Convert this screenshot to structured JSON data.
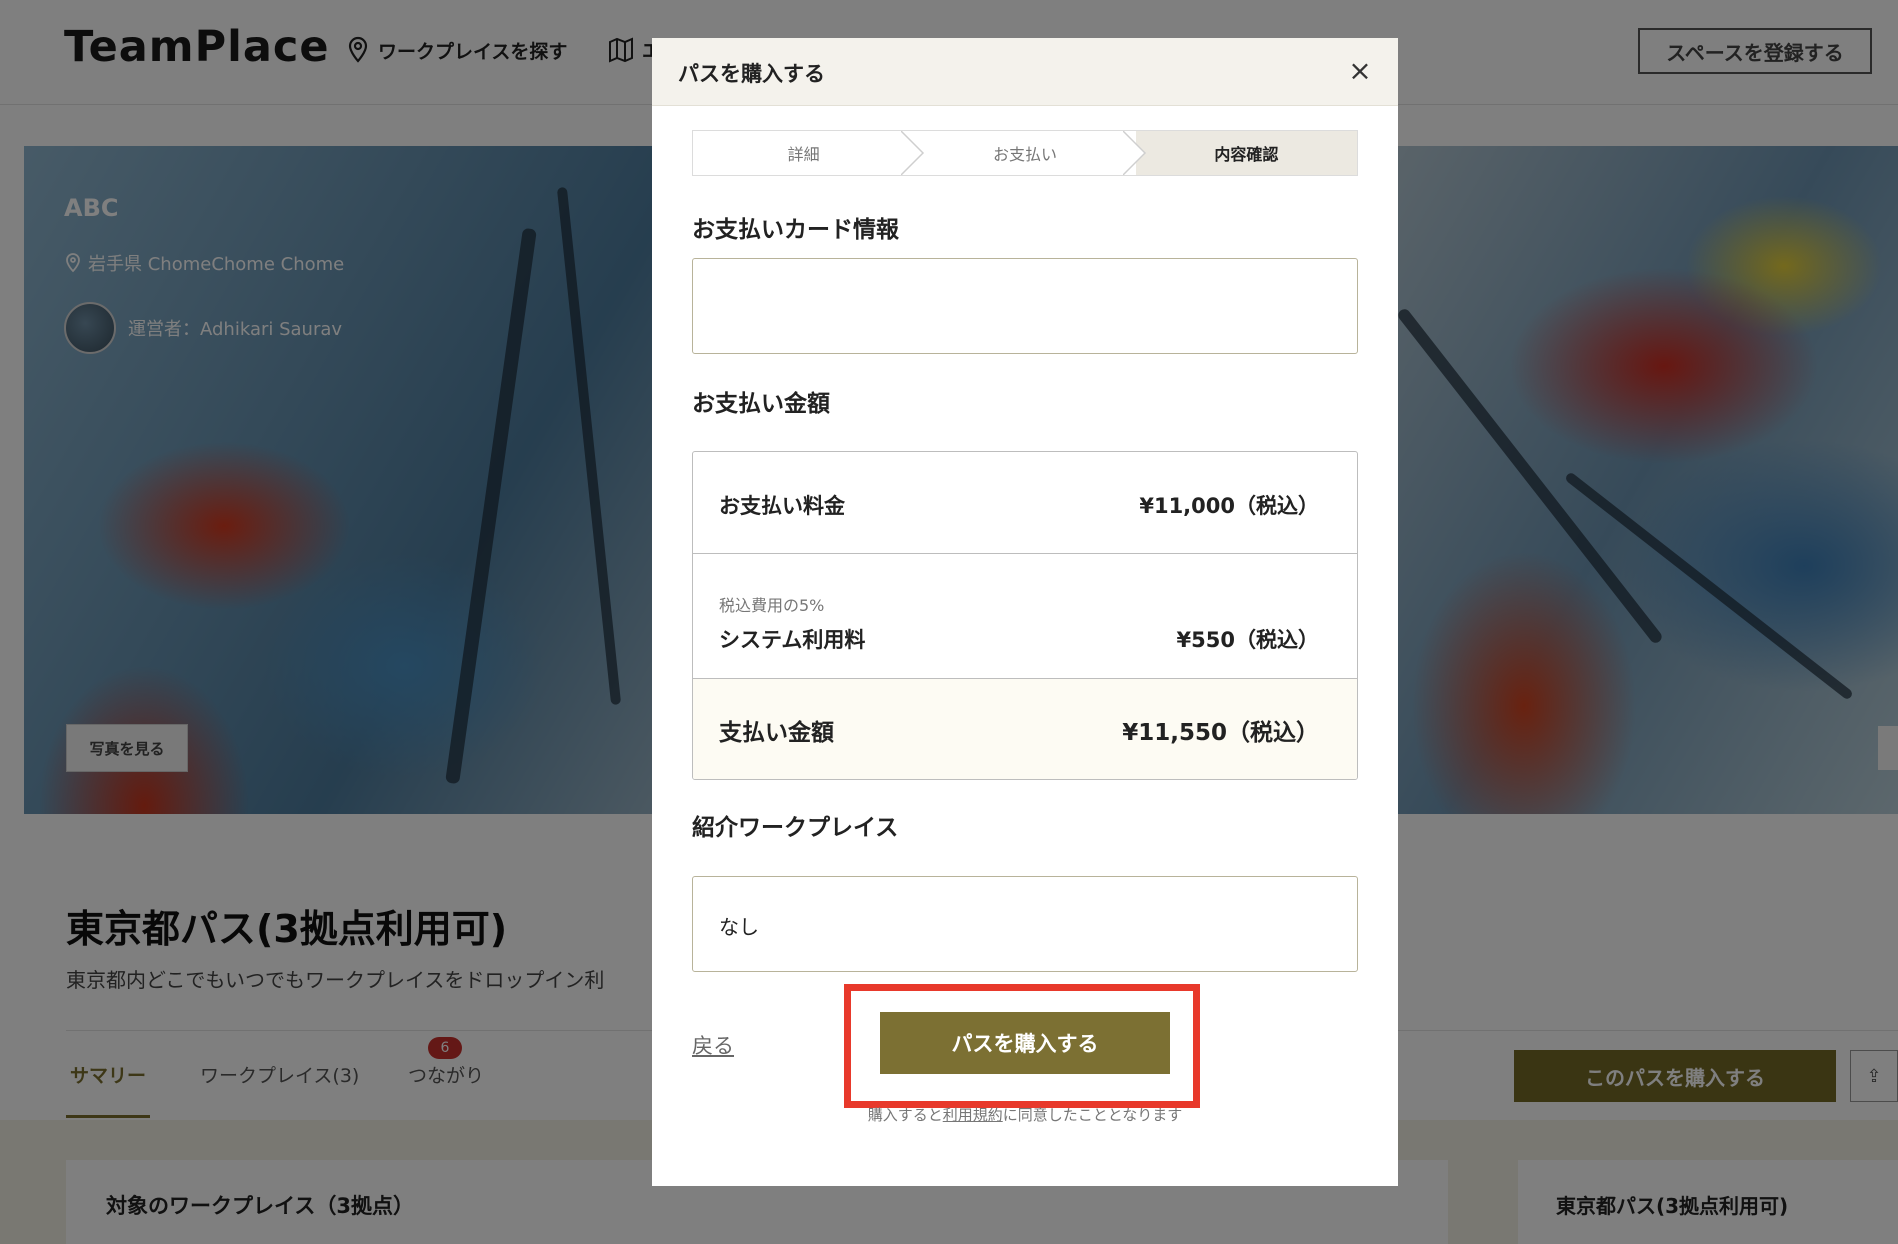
{
  "header": {
    "logo": "TeamPlace",
    "nav": [
      {
        "label": "ワークプレイスを探す",
        "icon": "map-pin-icon"
      },
      {
        "label": "エ",
        "icon": "map-icon"
      }
    ],
    "register_button": "スペースを登録する"
  },
  "hero": {
    "title": "ABC",
    "location": "岩手県 ChomeChome Chome",
    "owner": "運営者：Adhikari Saurav",
    "photos_button": "写真を見る"
  },
  "pass": {
    "title": "東京都パス(3拠点利用可)",
    "description": "東京都内どこでもいつでもワークプレイスをドロップイン利"
  },
  "tabs": {
    "summary": "サマリー",
    "workplaces": "ワークプレイス(3)",
    "connections": "つながり",
    "connections_badge": "6"
  },
  "actions": {
    "buy_pass": "このパスを購入する",
    "share_icon": "⇪"
  },
  "cards": {
    "target_workplaces": "対象のワークプレイス（3拠点）",
    "side_pass_title": "東京都パス(3拠点利用可)"
  },
  "modal": {
    "title": "パスを購入する",
    "close": "×",
    "steps": [
      "詳細",
      "お支払い",
      "内容確認"
    ],
    "card_section": "お支払いカード情報",
    "amount_section": "お支払い金額",
    "rows": {
      "fee_label": "お支払い料金",
      "fee_value": "¥11,000（税込）",
      "system_sub": "税込費用の5%",
      "system_label": "システム利用料",
      "system_value": "¥550（税込）",
      "total_label": "支払い金額",
      "total_value": "¥11,550（税込）"
    },
    "referral_section": "紹介ワークプレイス",
    "referral_value": "なし",
    "back": "戻る",
    "purchase_button": "パスを購入する",
    "terms_prefix": "購入すると",
    "terms_link": "利用規約",
    "terms_suffix": "に同意したこととなります"
  },
  "colors": {
    "accent": "#7c7033",
    "highlight": "#e8392b",
    "badge": "#c9302c"
  }
}
